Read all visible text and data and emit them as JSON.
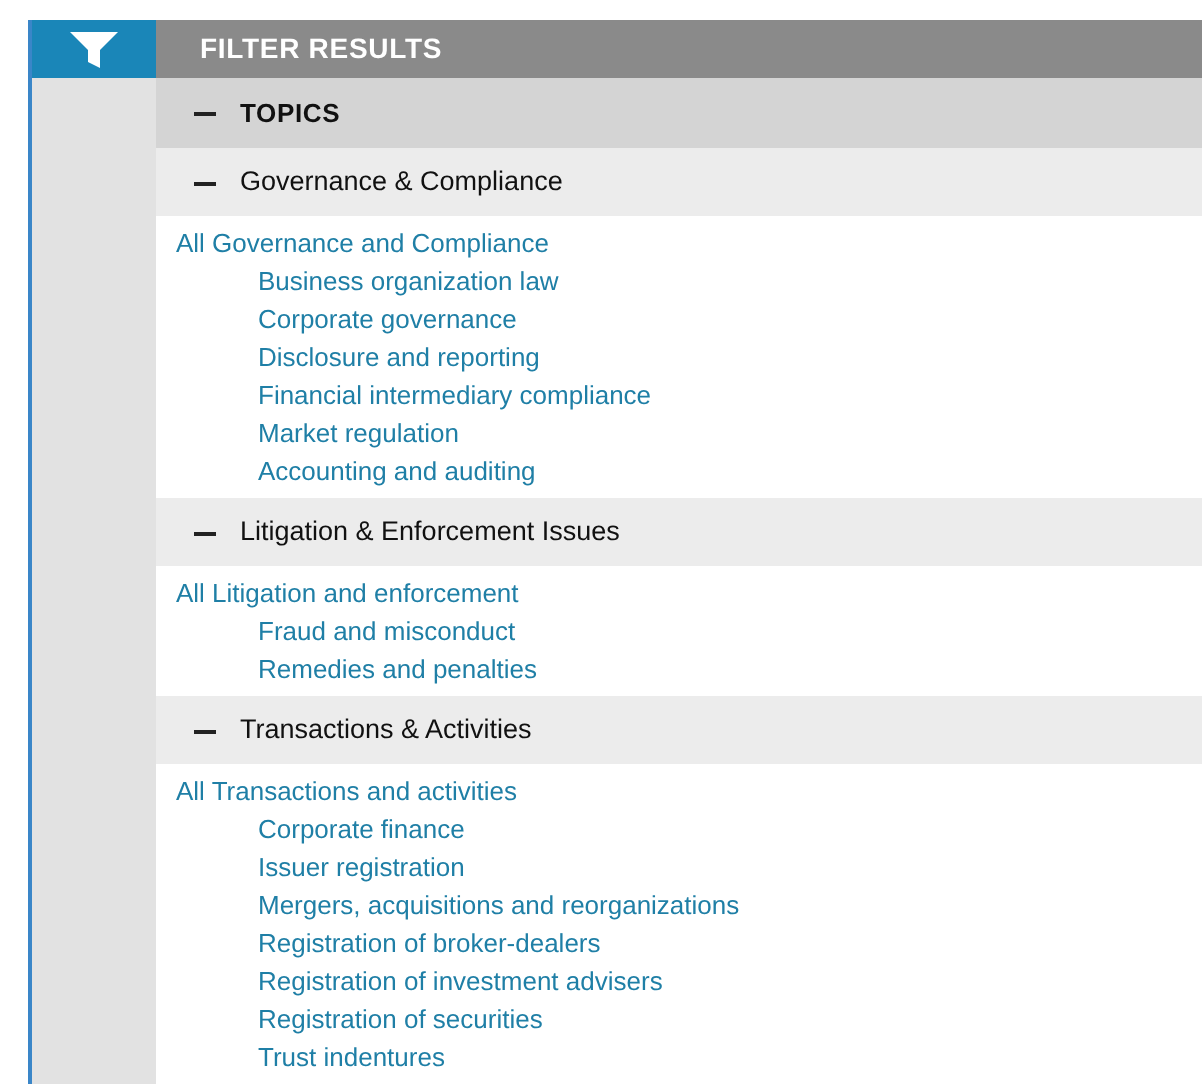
{
  "header": {
    "title": "FILTER RESULTS"
  },
  "section": {
    "title": "TOPICS",
    "expanded": true
  },
  "groups": [
    {
      "title": "Governance & Compliance",
      "expanded": true,
      "all_link": "All Governance and Compliance",
      "items": [
        "Business organization law",
        "Corporate governance",
        "Disclosure and reporting",
        "Financial intermediary compliance",
        "Market regulation",
        "Accounting and auditing"
      ]
    },
    {
      "title": "Litigation & Enforcement Issues",
      "expanded": true,
      "all_link": "All Litigation and enforcement",
      "items": [
        "Fraud and misconduct",
        "Remedies and penalties"
      ]
    },
    {
      "title": "Transactions & Activities",
      "expanded": true,
      "all_link": "All Transactions and activities",
      "items": [
        "Corporate finance",
        "Issuer registration",
        "Mergers, acquisitions and reorganizations",
        "Registration of broker-dealers",
        "Registration of investment advisers",
        "Registration of securities",
        "Trust indentures"
      ]
    }
  ]
}
